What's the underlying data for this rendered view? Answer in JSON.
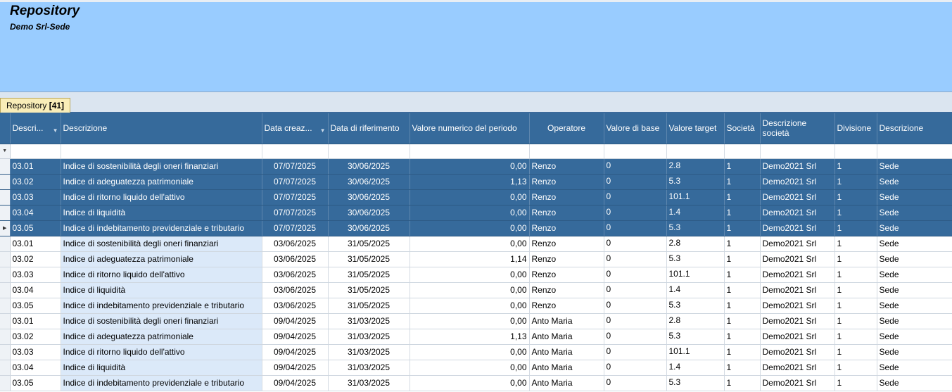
{
  "header": {
    "title": "Repository",
    "subtitle": "Demo Srl-Sede"
  },
  "tab": {
    "label": "Repository",
    "count": "[41]"
  },
  "columns": [
    "Descri...",
    "Descrizione",
    "Data creaz...",
    "Data di riferimento",
    "Valore numerico del periodo",
    "Operatore",
    "Valore di base",
    "Valore target",
    "Società",
    "Descrizione società",
    "Divisione",
    "Descrizione"
  ],
  "filter_icon": "funnel-icon",
  "rows": [
    {
      "selected": true,
      "indicator": "",
      "cells": [
        "03.01",
        "Indice di sostenibilità degli oneri finanziari",
        "07/07/2025",
        "30/06/2025",
        "0,00",
        "Renzo",
        "0",
        "2.8",
        "1",
        "Demo2021 Srl",
        "1",
        "Sede"
      ]
    },
    {
      "selected": true,
      "indicator": "",
      "cells": [
        "03.02",
        "Indice di adeguatezza patrimoniale",
        "07/07/2025",
        "30/06/2025",
        "1,13",
        "Renzo",
        "0",
        "5.3",
        "1",
        "Demo2021 Srl",
        "1",
        "Sede"
      ]
    },
    {
      "selected": true,
      "indicator": "",
      "cells": [
        "03.03",
        "Indice di ritorno liquido dell'attivo",
        "07/07/2025",
        "30/06/2025",
        "0,00",
        "Renzo",
        "0",
        "101.1",
        "1",
        "Demo2021 Srl",
        "1",
        "Sede"
      ]
    },
    {
      "selected": true,
      "indicator": "",
      "cells": [
        "03.04",
        "Indice di liquidità",
        "07/07/2025",
        "30/06/2025",
        "0,00",
        "Renzo",
        "0",
        "1.4",
        "1",
        "Demo2021 Srl",
        "1",
        "Sede"
      ]
    },
    {
      "selected": true,
      "indicator": "▶",
      "cells": [
        "03.05",
        "Indice di indebitamento previdenziale e tributario",
        "07/07/2025",
        "30/06/2025",
        "0,00",
        "Renzo",
        "0",
        "5.3",
        "1",
        "Demo2021 Srl",
        "1",
        "Sede"
      ]
    },
    {
      "selected": false,
      "indicator": "",
      "cells": [
        "03.01",
        "Indice di sostenibilità degli oneri finanziari",
        "03/06/2025",
        "31/05/2025",
        "0,00",
        "Renzo",
        "0",
        "2.8",
        "1",
        "Demo2021 Srl",
        "1",
        "Sede"
      ]
    },
    {
      "selected": false,
      "indicator": "",
      "cells": [
        "03.02",
        "Indice di adeguatezza patrimoniale",
        "03/06/2025",
        "31/05/2025",
        "1,14",
        "Renzo",
        "0",
        "5.3",
        "1",
        "Demo2021 Srl",
        "1",
        "Sede"
      ]
    },
    {
      "selected": false,
      "indicator": "",
      "cells": [
        "03.03",
        "Indice di ritorno liquido dell'attivo",
        "03/06/2025",
        "31/05/2025",
        "0,00",
        "Renzo",
        "0",
        "101.1",
        "1",
        "Demo2021 Srl",
        "1",
        "Sede"
      ]
    },
    {
      "selected": false,
      "indicator": "",
      "cells": [
        "03.04",
        "Indice di liquidità",
        "03/06/2025",
        "31/05/2025",
        "0,00",
        "Renzo",
        "0",
        "1.4",
        "1",
        "Demo2021 Srl",
        "1",
        "Sede"
      ]
    },
    {
      "selected": false,
      "indicator": "",
      "cells": [
        "03.05",
        "Indice di indebitamento previdenziale e tributario",
        "03/06/2025",
        "31/05/2025",
        "0,00",
        "Renzo",
        "0",
        "5.3",
        "1",
        "Demo2021 Srl",
        "1",
        "Sede"
      ]
    },
    {
      "selected": false,
      "indicator": "",
      "cells": [
        "03.01",
        "Indice di sostenibilità degli oneri finanziari",
        "09/04/2025",
        "31/03/2025",
        "0,00",
        "Anto Maria",
        "0",
        "2.8",
        "1",
        "Demo2021 Srl",
        "1",
        "Sede"
      ]
    },
    {
      "selected": false,
      "indicator": "",
      "cells": [
        "03.02",
        "Indice di adeguatezza patrimoniale",
        "09/04/2025",
        "31/03/2025",
        "1,13",
        "Anto Maria",
        "0",
        "5.3",
        "1",
        "Demo2021 Srl",
        "1",
        "Sede"
      ]
    },
    {
      "selected": false,
      "indicator": "",
      "cells": [
        "03.03",
        "Indice di ritorno liquido dell'attivo",
        "09/04/2025",
        "31/03/2025",
        "0,00",
        "Anto Maria",
        "0",
        "101.1",
        "1",
        "Demo2021 Srl",
        "1",
        "Sede"
      ]
    },
    {
      "selected": false,
      "indicator": "",
      "cells": [
        "03.04",
        "Indice di liquidità",
        "09/04/2025",
        "31/03/2025",
        "0,00",
        "Anto Maria",
        "0",
        "1.4",
        "1",
        "Demo2021 Srl",
        "1",
        "Sede"
      ]
    },
    {
      "selected": false,
      "indicator": "",
      "cells": [
        "03.05",
        "Indice di indebitamento previdenziale e tributario",
        "09/04/2025",
        "31/03/2025",
        "0,00",
        "Anto Maria",
        "0",
        "5.3",
        "1",
        "Demo2021 Srl",
        "1",
        "Sede"
      ]
    }
  ]
}
